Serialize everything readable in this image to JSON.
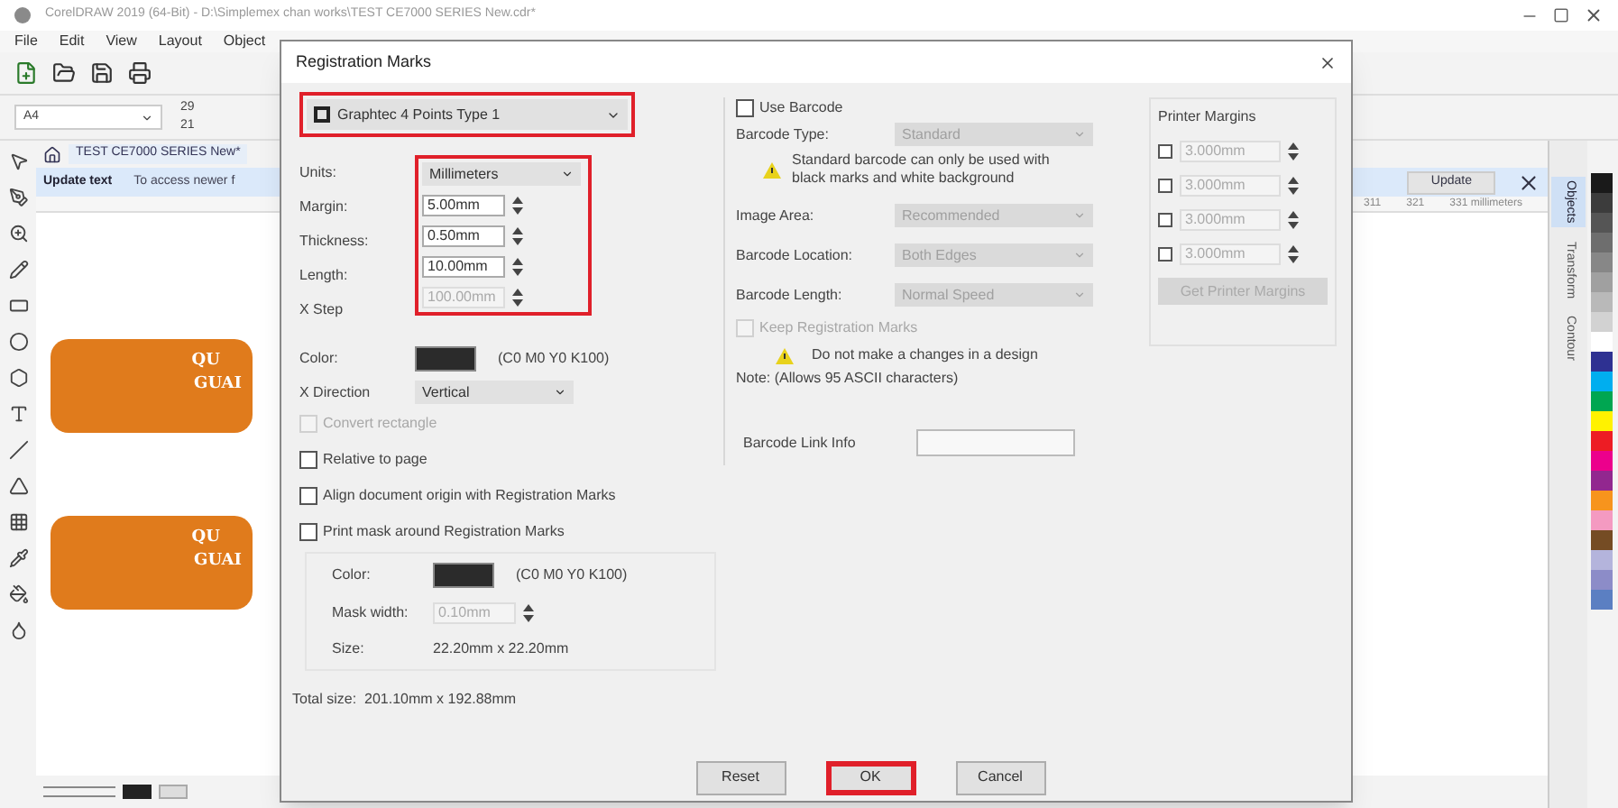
{
  "app": {
    "title": "CorelDRAW 2019 (64-Bit) - D:\\Simplemex chan works\\TEST CE7000 SERIES New.cdr*",
    "menu": [
      "File",
      "Edit",
      "View",
      "Layout",
      "Object"
    ],
    "page_size": "A4",
    "width_value": "29",
    "height_value": "21"
  },
  "document": {
    "tab": "TEST CE7000 SERIES New*",
    "update_title": "Update text",
    "update_message": "To access newer f",
    "update_button": "Update",
    "ruler": [
      "311",
      "321",
      "331 millimeters"
    ]
  },
  "stickers": [
    {
      "line1": "QU",
      "line2": "GUAI"
    },
    {
      "line1": "QU",
      "line2": "GUAI"
    }
  ],
  "dockers": [
    {
      "label": "Objects",
      "selected": true
    },
    {
      "label": "Transform",
      "selected": false
    },
    {
      "label": "Contour",
      "selected": false
    }
  ],
  "palette": [
    {
      "color": "#1a1a1a"
    },
    {
      "color": "#3c3c3c"
    },
    {
      "color": "#555555"
    },
    {
      "color": "#6e6e6e"
    },
    {
      "color": "#878787"
    },
    {
      "color": "#a0a0a0"
    },
    {
      "color": "#b9b9b9"
    },
    {
      "color": "#d2d2d2"
    },
    {
      "color": "#ffffff"
    },
    {
      "color": "#2e3192"
    },
    {
      "color": "#00aeef"
    },
    {
      "color": "#00a651"
    },
    {
      "color": "#fff200"
    },
    {
      "color": "#ed1c24"
    },
    {
      "color": "#ec008c"
    },
    {
      "color": "#92278f"
    },
    {
      "color": "#f7941d"
    },
    {
      "color": "#f49ac1"
    },
    {
      "color": "#754c24"
    },
    {
      "color": "#b4b4dc"
    },
    {
      "color": "#8c8cc8"
    },
    {
      "color": "#5b7fc2"
    }
  ],
  "dialog": {
    "title": "Registration Marks",
    "mark_style": {
      "value": "Graphtec 4 Points Type 1",
      "highlighted": true
    },
    "settings": {
      "highlighted": true,
      "units_label": "Units:",
      "units_value": "Millimeters",
      "fields": [
        {
          "label": "Margin:",
          "value": "5.00mm",
          "disabled": false
        },
        {
          "label": "Thickness:",
          "value": "0.50mm",
          "disabled": false
        },
        {
          "label": "Length:",
          "value": "10.00mm",
          "disabled": false
        },
        {
          "label": "X Step",
          "value": "100.00mm",
          "disabled": true
        }
      ]
    },
    "color_label": "Color:",
    "color_value": "(C0 M0 Y0 K100)",
    "direction_label": "X Direction",
    "direction_value": "Vertical",
    "checkboxes": [
      {
        "label": "Convert rectangle",
        "checked": false,
        "disabled": true
      },
      {
        "label": "Relative to page",
        "checked": false,
        "disabled": false
      },
      {
        "label": "Align document origin with Registration Marks",
        "checked": false,
        "disabled": false
      },
      {
        "label": "Print mask around Registration Marks",
        "checked": false,
        "disabled": false
      }
    ],
    "mask": {
      "color_label": "Color:",
      "color_value": "(C0 M0 Y0 K100)",
      "width_label": "Mask width:",
      "width_value": "0.10mm",
      "size_label": "Size:",
      "size_value": "22.20mm x 22.20mm"
    },
    "total_size": "Total size:  201.10mm x 192.88mm",
    "barcode": {
      "use_label": "Use Barcode",
      "checked": false,
      "type_label": "Barcode Type:",
      "type_value": "Standard",
      "warning": "Standard barcode can only be used with black marks and white background",
      "rows": [
        {
          "label": "Image Area:",
          "value": "Recommended"
        },
        {
          "label": "Barcode Location:",
          "value": "Both Edges"
        },
        {
          "label": "Barcode Length:",
          "value": "Normal Speed"
        }
      ],
      "keep_label": "Keep Registration Marks",
      "keep_checked": false,
      "design_warning": "Do not make a changes in a design",
      "note": "Note: (Allows 95 ASCII characters)",
      "link_label": "Barcode Link Info"
    },
    "printer_margins": {
      "title": "Printer Margins",
      "rows": [
        {
          "value": "3.000mm",
          "checked": false
        },
        {
          "value": "3.000mm",
          "checked": false
        },
        {
          "value": "3.000mm",
          "checked": false
        },
        {
          "value": "3.000mm",
          "checked": false
        }
      ],
      "button": "Get Printer Margins"
    },
    "buttons": [
      {
        "label": "Reset",
        "highlighted": false
      },
      {
        "label": "OK",
        "highlighted": true
      },
      {
        "label": "Cancel",
        "highlighted": false
      }
    ]
  }
}
